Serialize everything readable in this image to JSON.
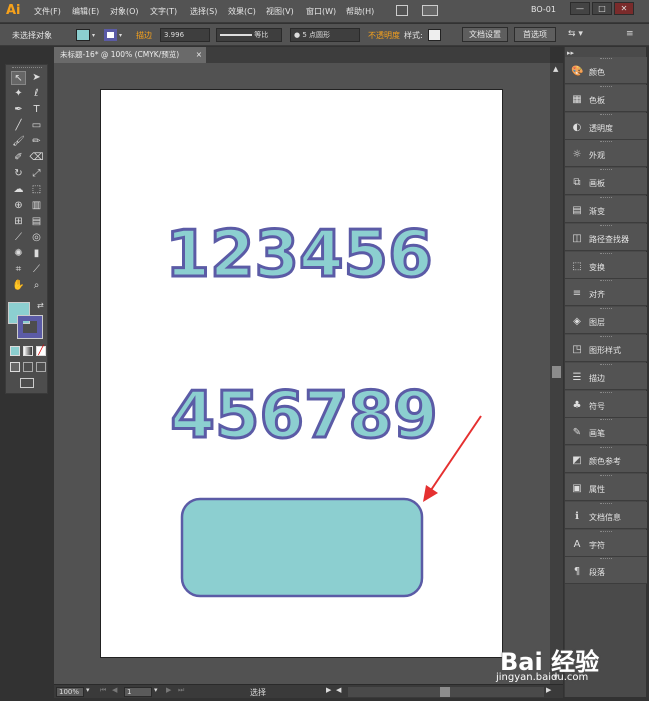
{
  "app": {
    "logo": "Ai",
    "workspace": "BO-01",
    "window_buttons": [
      "—",
      "□",
      "✕"
    ]
  },
  "menu": [
    "文件(F)",
    "编辑(E)",
    "对象(O)",
    "文字(T)",
    "选择(S)",
    "效果(C)",
    "视图(V)",
    "窗口(W)",
    "帮助(H)"
  ],
  "control_bar": {
    "selection": "未选择对象",
    "stroke_label": "描边",
    "stroke_weight": "3.996",
    "stroke_profile": "等比",
    "brush": "5 点圆形",
    "opacity_label": "不透明度",
    "style_label": "样式:",
    "doc_setup": "文档设置",
    "preferences": "首选项"
  },
  "document": {
    "tab_title": "未标题-16* @ 100% (CMYK/预览)"
  },
  "artwork": {
    "line1": "123456",
    "line2": "456789",
    "fill_color": "#8ccfd0",
    "stroke_color": "#5b5ba6",
    "arrow_color": "#e53030"
  },
  "status": {
    "zoom": "100%",
    "page": "1",
    "mode": "选择"
  },
  "panels": [
    {
      "label": "颜色",
      "icon": "palette-icon",
      "glyph": "🎨"
    },
    {
      "label": "色板",
      "icon": "swatches-icon",
      "glyph": "▦"
    },
    {
      "label": "透明度",
      "icon": "transparency-icon",
      "glyph": "◐"
    },
    {
      "label": "外观",
      "icon": "appearance-icon",
      "glyph": "☼"
    },
    {
      "label": "画板",
      "icon": "artboards-icon",
      "glyph": "⧉"
    },
    {
      "label": "渐变",
      "icon": "gradient-icon",
      "glyph": "▤"
    },
    {
      "label": "路径查找器",
      "icon": "pathfinder-icon",
      "glyph": "◫"
    },
    {
      "label": "变换",
      "icon": "transform-icon",
      "glyph": "⬚"
    },
    {
      "label": "对齐",
      "icon": "align-icon",
      "glyph": "≡"
    },
    {
      "label": "图层",
      "icon": "layers-icon",
      "glyph": "◈"
    },
    {
      "label": "图形样式",
      "icon": "graphic-styles-icon",
      "glyph": "◳"
    },
    {
      "label": "描边",
      "icon": "stroke-icon",
      "glyph": "☰"
    },
    {
      "label": "符号",
      "icon": "symbols-icon",
      "glyph": "♣"
    },
    {
      "label": "画笔",
      "icon": "brushes-icon",
      "glyph": "✎"
    },
    {
      "label": "颜色参考",
      "icon": "color-guide-icon",
      "glyph": "◩"
    },
    {
      "label": "属性",
      "icon": "attributes-icon",
      "glyph": "▣"
    },
    {
      "label": "文档信息",
      "icon": "document-info-icon",
      "glyph": "ℹ"
    },
    {
      "label": "字符",
      "icon": "character-icon",
      "glyph": "A"
    },
    {
      "label": "段落",
      "icon": "paragraph-icon",
      "glyph": "¶"
    }
  ],
  "watermark": {
    "brand": "Bai 经验",
    "url": "jingyan.baidu.com"
  }
}
